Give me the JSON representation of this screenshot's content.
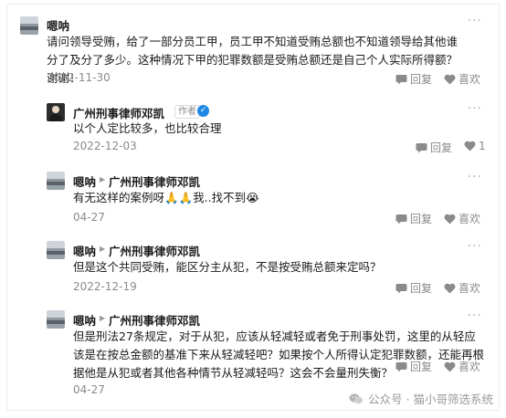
{
  "comments": [
    {
      "author": "嗯呐",
      "text": "请问领导受贿，给了一部分员工甲，员工甲不知道受贿总额也不知道领导给其他谁分了及分了多少。这种情况下甲的犯罪数额是受贿总额还是自己个人实际所得额？谢谢！",
      "date": "2022-11-30",
      "reply_label": "回复",
      "like_label": "喜欢"
    },
    {
      "author": "广州刑事律师邓凯",
      "author_badge": "作者",
      "text": "以个人定比较多，也比较合理",
      "date": "2022-12-03",
      "reply_label": "回复",
      "like_count": "1"
    },
    {
      "author": "嗯呐",
      "reply_to": "广州刑事律师邓凯",
      "text": "有无这样的案例呀🙏🙏我..找不到😭",
      "date": "04-27",
      "reply_label": "回复",
      "like_label": "喜欢"
    },
    {
      "author": "嗯呐",
      "reply_to": "广州刑事律师邓凯",
      "text": "但是这个共同受贿，能区分主从犯，不是按受贿总额来定吗？",
      "date": "2022-12-19",
      "reply_label": "回复",
      "like_label": "喜欢"
    },
    {
      "author": "嗯呐",
      "reply_to": "广州刑事律师邓凯",
      "text": "但是刑法27条规定，对于从犯，应该从轻减轻或者免于刑事处罚，这里的从轻应该是在按总金额的基准下来从轻减轻吧？如果按个人所得认定犯罪数额，还能再根据他是从犯或者其他各种情节从轻减轻吗？这会不会量刑失衡？",
      "date": "04-27",
      "reply_label": "回复",
      "like_label": "喜欢"
    }
  ],
  "watermark": "公众号 · 猫小哥筛选系统",
  "more_label": "···"
}
